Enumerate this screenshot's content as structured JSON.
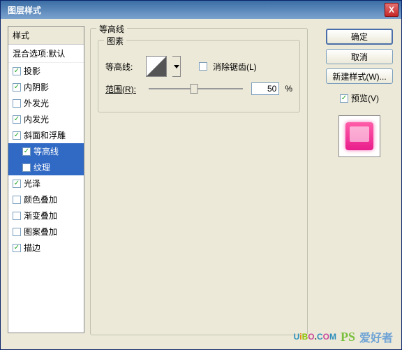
{
  "title": "图层样式",
  "close_label": "X",
  "styles": {
    "header": "样式",
    "default_opts": "混合选项:默认",
    "items": [
      {
        "label": "投影",
        "checked": true,
        "selected": false,
        "sub": false
      },
      {
        "label": "内阴影",
        "checked": true,
        "selected": false,
        "sub": false
      },
      {
        "label": "外发光",
        "checked": false,
        "selected": false,
        "sub": false
      },
      {
        "label": "内发光",
        "checked": true,
        "selected": false,
        "sub": false
      },
      {
        "label": "斜面和浮雕",
        "checked": true,
        "selected": false,
        "sub": false
      },
      {
        "label": "等高线",
        "checked": true,
        "selected": true,
        "sub": true
      },
      {
        "label": "纹理",
        "checked": false,
        "selected": true,
        "sub": true
      },
      {
        "label": "光泽",
        "checked": true,
        "selected": false,
        "sub": false
      },
      {
        "label": "颜色叠加",
        "checked": false,
        "selected": false,
        "sub": false
      },
      {
        "label": "渐变叠加",
        "checked": false,
        "selected": false,
        "sub": false
      },
      {
        "label": "图案叠加",
        "checked": false,
        "selected": false,
        "sub": false
      },
      {
        "label": "描边",
        "checked": true,
        "selected": false,
        "sub": false
      }
    ]
  },
  "panel": {
    "outer_title": "等高线",
    "inner_title": "图素",
    "contour_label": "等高线:",
    "antialias_label": "消除锯齿(L)",
    "antialias_checked": false,
    "range_label": "范围(R):",
    "range_value": "50",
    "range_unit": "%"
  },
  "buttons": {
    "ok": "确定",
    "cancel": "取消",
    "new_style": "新建样式(W)...",
    "preview": "预览(V)",
    "preview_checked": true
  },
  "watermark": {
    "u": "U",
    "i": "i",
    "b": "B",
    "o": "O",
    "dot": ".",
    "c": "C",
    "m": "M",
    "ps": "PS",
    "cn": "爱好者"
  }
}
